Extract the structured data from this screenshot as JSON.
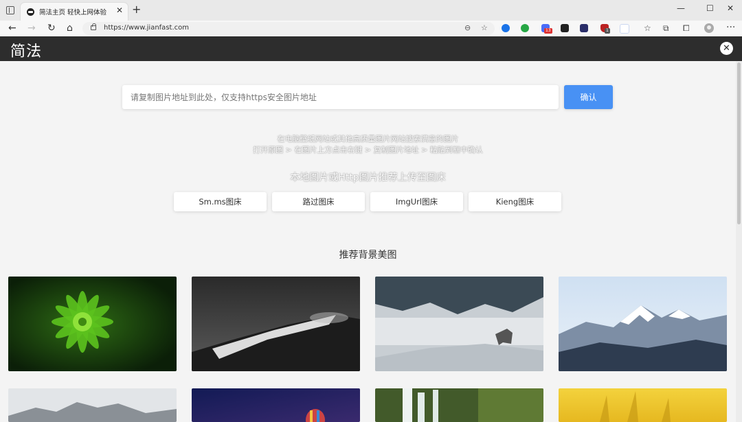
{
  "browser": {
    "tab_title": "简法主页 轻快上网体验",
    "new_tab": "+",
    "tab_close": "✕",
    "url": "https://www.jianfast.com",
    "badge_red": "13",
    "badge_gray": "1",
    "window_controls": [
      "—",
      "☐",
      "✕"
    ],
    "more": "···"
  },
  "site": {
    "logo": "简法",
    "close": "✕",
    "search": {
      "placeholder": "请复制图片地址到此处，仅支持https安全图片地址",
      "value": ""
    },
    "confirm_label": "确认",
    "hint_line1": "在电脑壁纸网站或其他高质量图片网站搜索满意的图片",
    "hint_line2": "打开原图 > 在图片上方点击右键 > 复制图片地址 > 粘贴到框中确认",
    "upload_title": "本地图片或Http图片推荐上传至图床",
    "hosts": [
      "Sm.ms图床",
      "路过图床",
      "ImgUrl图床",
      "Kieng图床"
    ],
    "section_title": "推荐背景美图"
  },
  "colors": {
    "accent": "#4891f4",
    "header_bg": "#2d2d2d",
    "page_bg": "#f4f4f4"
  },
  "icons": [
    "back-icon",
    "forward-icon",
    "refresh-icon",
    "home-icon",
    "lock-icon",
    "zoom-icon",
    "favorite-add-icon",
    "favorites-icon",
    "collections-icon",
    "extensions-icon",
    "profile-icon",
    "close-circle-icon"
  ]
}
